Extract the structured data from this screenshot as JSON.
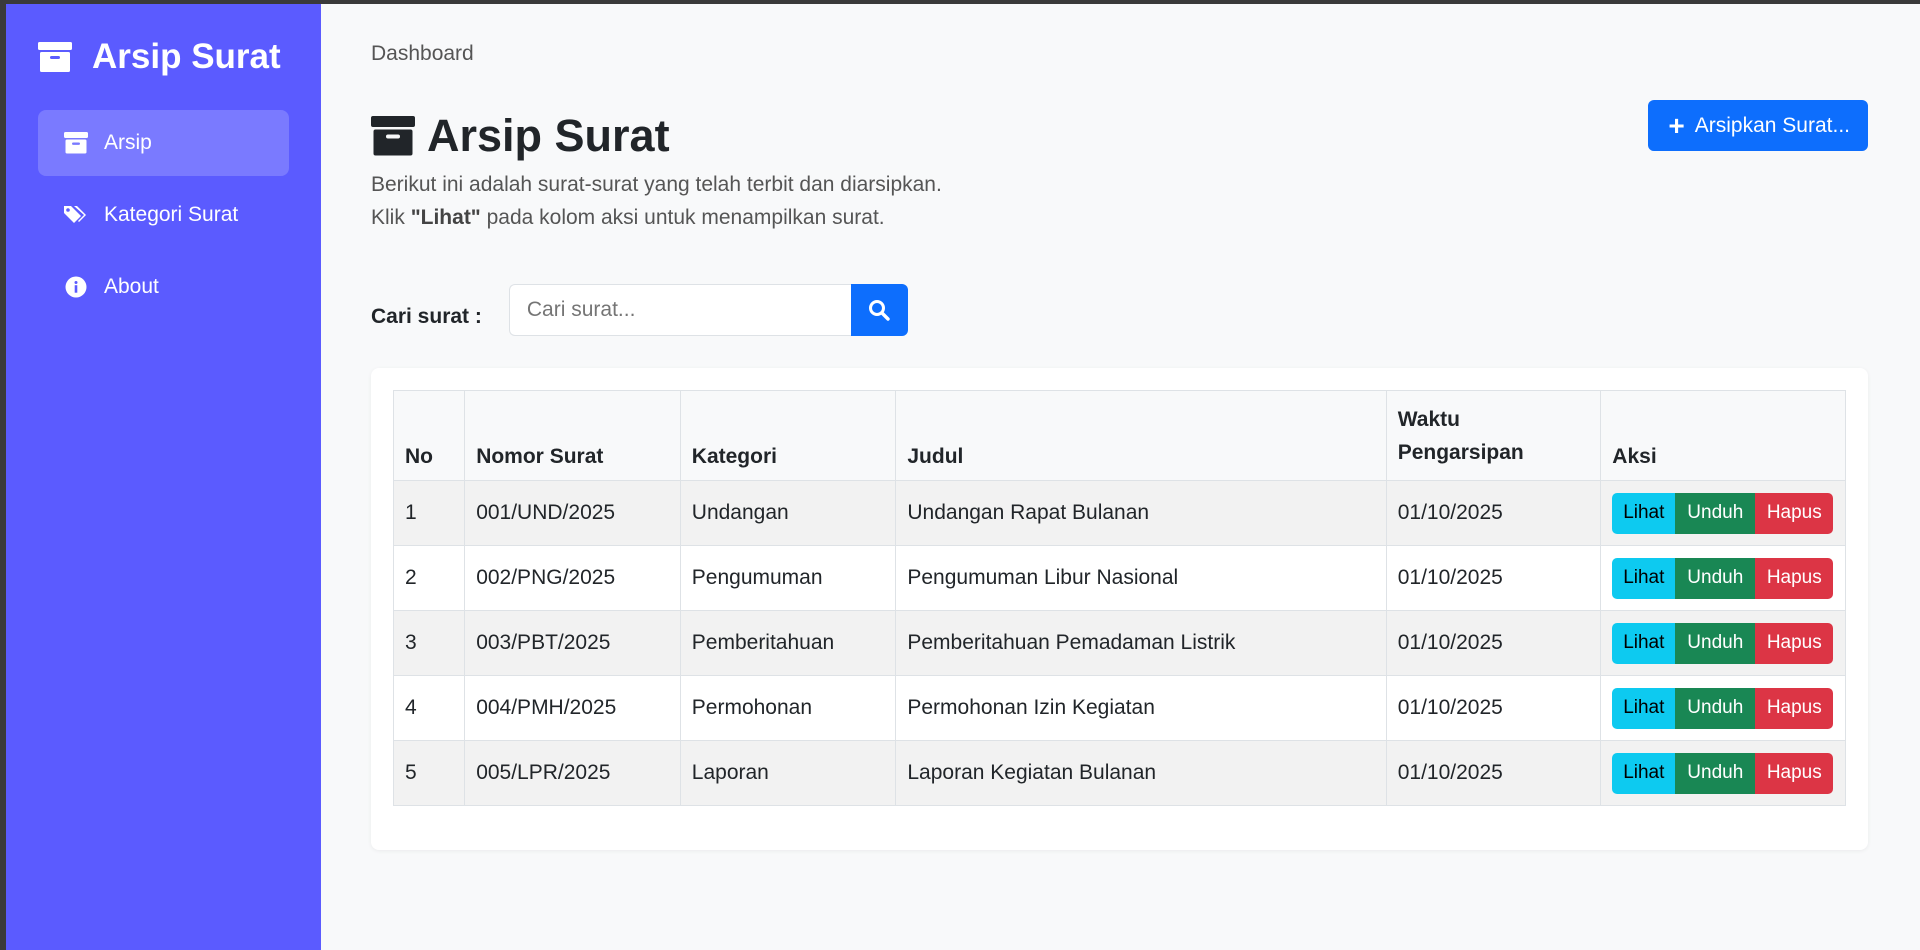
{
  "sidebar": {
    "brand": "Arsip Surat",
    "items": [
      {
        "label": "Arsip",
        "icon": "archive-icon",
        "active": true
      },
      {
        "label": "Kategori Surat",
        "icon": "tags-icon",
        "active": false
      },
      {
        "label": "About",
        "icon": "info-circle-icon",
        "active": false
      }
    ]
  },
  "main": {
    "breadcrumb": "Dashboard",
    "title": "Arsip Surat",
    "add_button": "Arsipkan Surat...",
    "desc_line1": "Berikut ini adalah surat-surat yang telah terbit dan diarsipkan.",
    "desc_line2_prefix": "Klik ",
    "desc_line2_bold": "\"Lihat\"",
    "desc_line2_suffix": " pada kolom aksi untuk menampilkan surat.",
    "search_label": "Cari surat :",
    "search_placeholder": "Cari surat..."
  },
  "table": {
    "headers": [
      "No",
      "Nomor Surat",
      "Kategori",
      "Judul",
      "Waktu Pengarsipan",
      "Aksi"
    ],
    "actions": {
      "view": "Lihat",
      "download": "Unduh",
      "delete": "Hapus"
    },
    "rows": [
      {
        "no": "1",
        "nomor": "001/UND/2025",
        "kategori": "Undangan",
        "judul": "Undangan Rapat Bulanan",
        "waktu": "01/10/2025"
      },
      {
        "no": "2",
        "nomor": "002/PNG/2025",
        "kategori": "Pengumuman",
        "judul": "Pengumuman Libur Nasional",
        "waktu": "01/10/2025"
      },
      {
        "no": "3",
        "nomor": "003/PBT/2025",
        "kategori": "Pemberitahuan",
        "judul": "Pemberitahuan Pemadaman Listrik",
        "waktu": "01/10/2025"
      },
      {
        "no": "4",
        "nomor": "004/PMH/2025",
        "kategori": "Permohonan",
        "judul": "Permohonan Izin Kegiatan",
        "waktu": "01/10/2025"
      },
      {
        "no": "5",
        "nomor": "005/LPR/2025",
        "kategori": "Laporan",
        "judul": "Laporan Kegiatan Bulanan",
        "waktu": "01/10/2025"
      }
    ]
  },
  "colors": {
    "sidebar": "#5b5bff",
    "sidebar_active": "#7a7aff",
    "primary": "#0d6efd",
    "info": "#0dcaf0",
    "success": "#198754",
    "danger": "#dc3545"
  }
}
